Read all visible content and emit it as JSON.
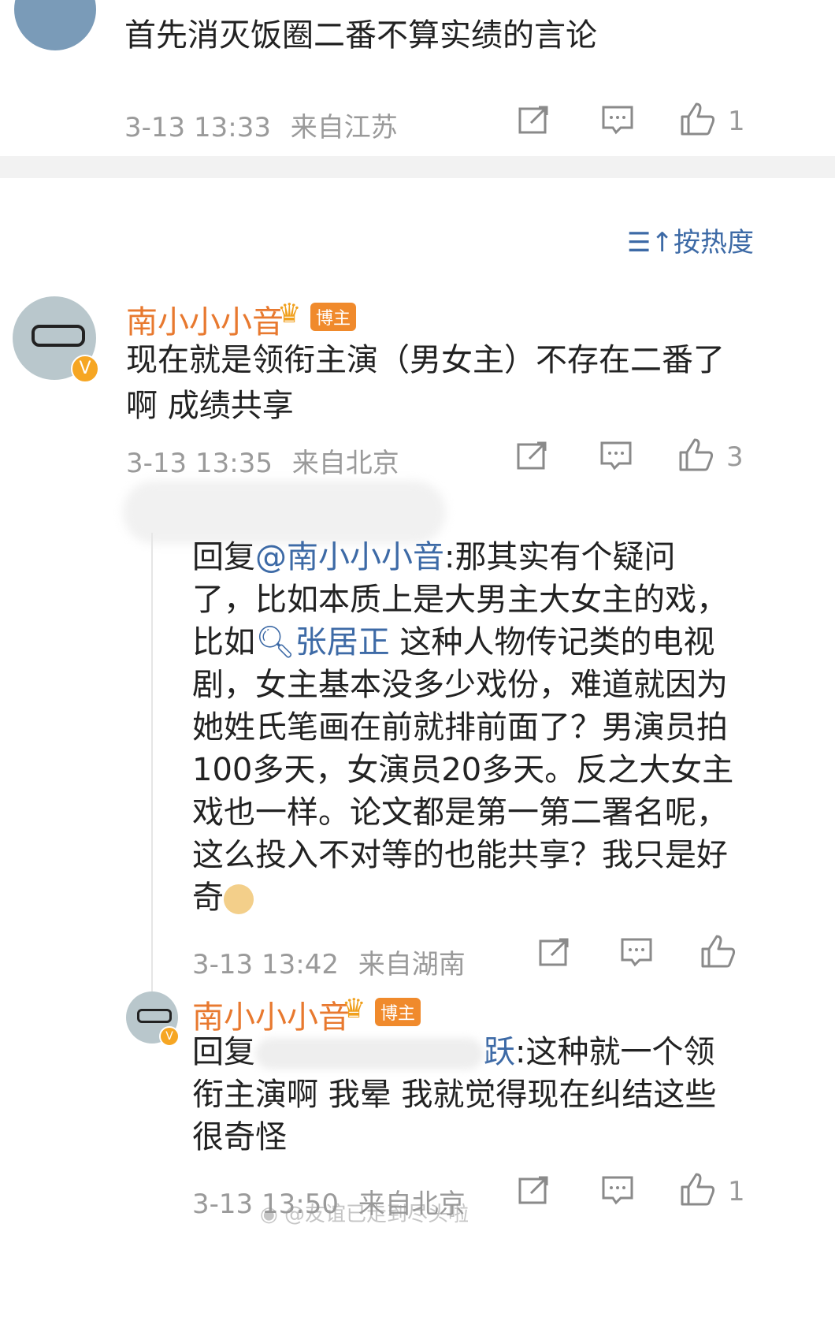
{
  "comment_top": {
    "text": "首先消灭饭圈二番不算实绩的言论",
    "time": "3-13 13:33",
    "location": "来自江苏",
    "likes": "1"
  },
  "sort_label": "按热度",
  "comment_main": {
    "author": "南小小小音",
    "badge": "博主",
    "text": "现在就是领衔主演（男女主）不存在二番了啊 成绩共享",
    "time": "3-13 13:35",
    "location": "来自北京",
    "likes": "3"
  },
  "reply_1": {
    "prefix": "回复",
    "mention": "@南小小小音",
    "body_a": ":那其实有个疑问了，比如本质上是大男主大女主的戏，比如",
    "topic": "张居正",
    "body_b": " 这种人物传记类的电视剧，女主基本没多少戏份，难道就因为她姓氏笔画在前就排前面了？男演员拍100多天，女演员20多天。反之大女主戏也一样。论文都是第一第二署名呢，这么投入不对等的也能共享？我只是好奇",
    "time": "3-13 13:42",
    "location": "来自湖南"
  },
  "reply_2": {
    "author": "南小小小音",
    "badge": "博主",
    "prefix": "回复",
    "tail": "跃",
    "body": ":这种就一个领衔主演啊 我晕 我就觉得现在纠结这些很奇怪",
    "time": "3-13 13:50",
    "location": "来自北京",
    "likes": "1"
  },
  "watermark": "@友谊已走到尽头啦"
}
